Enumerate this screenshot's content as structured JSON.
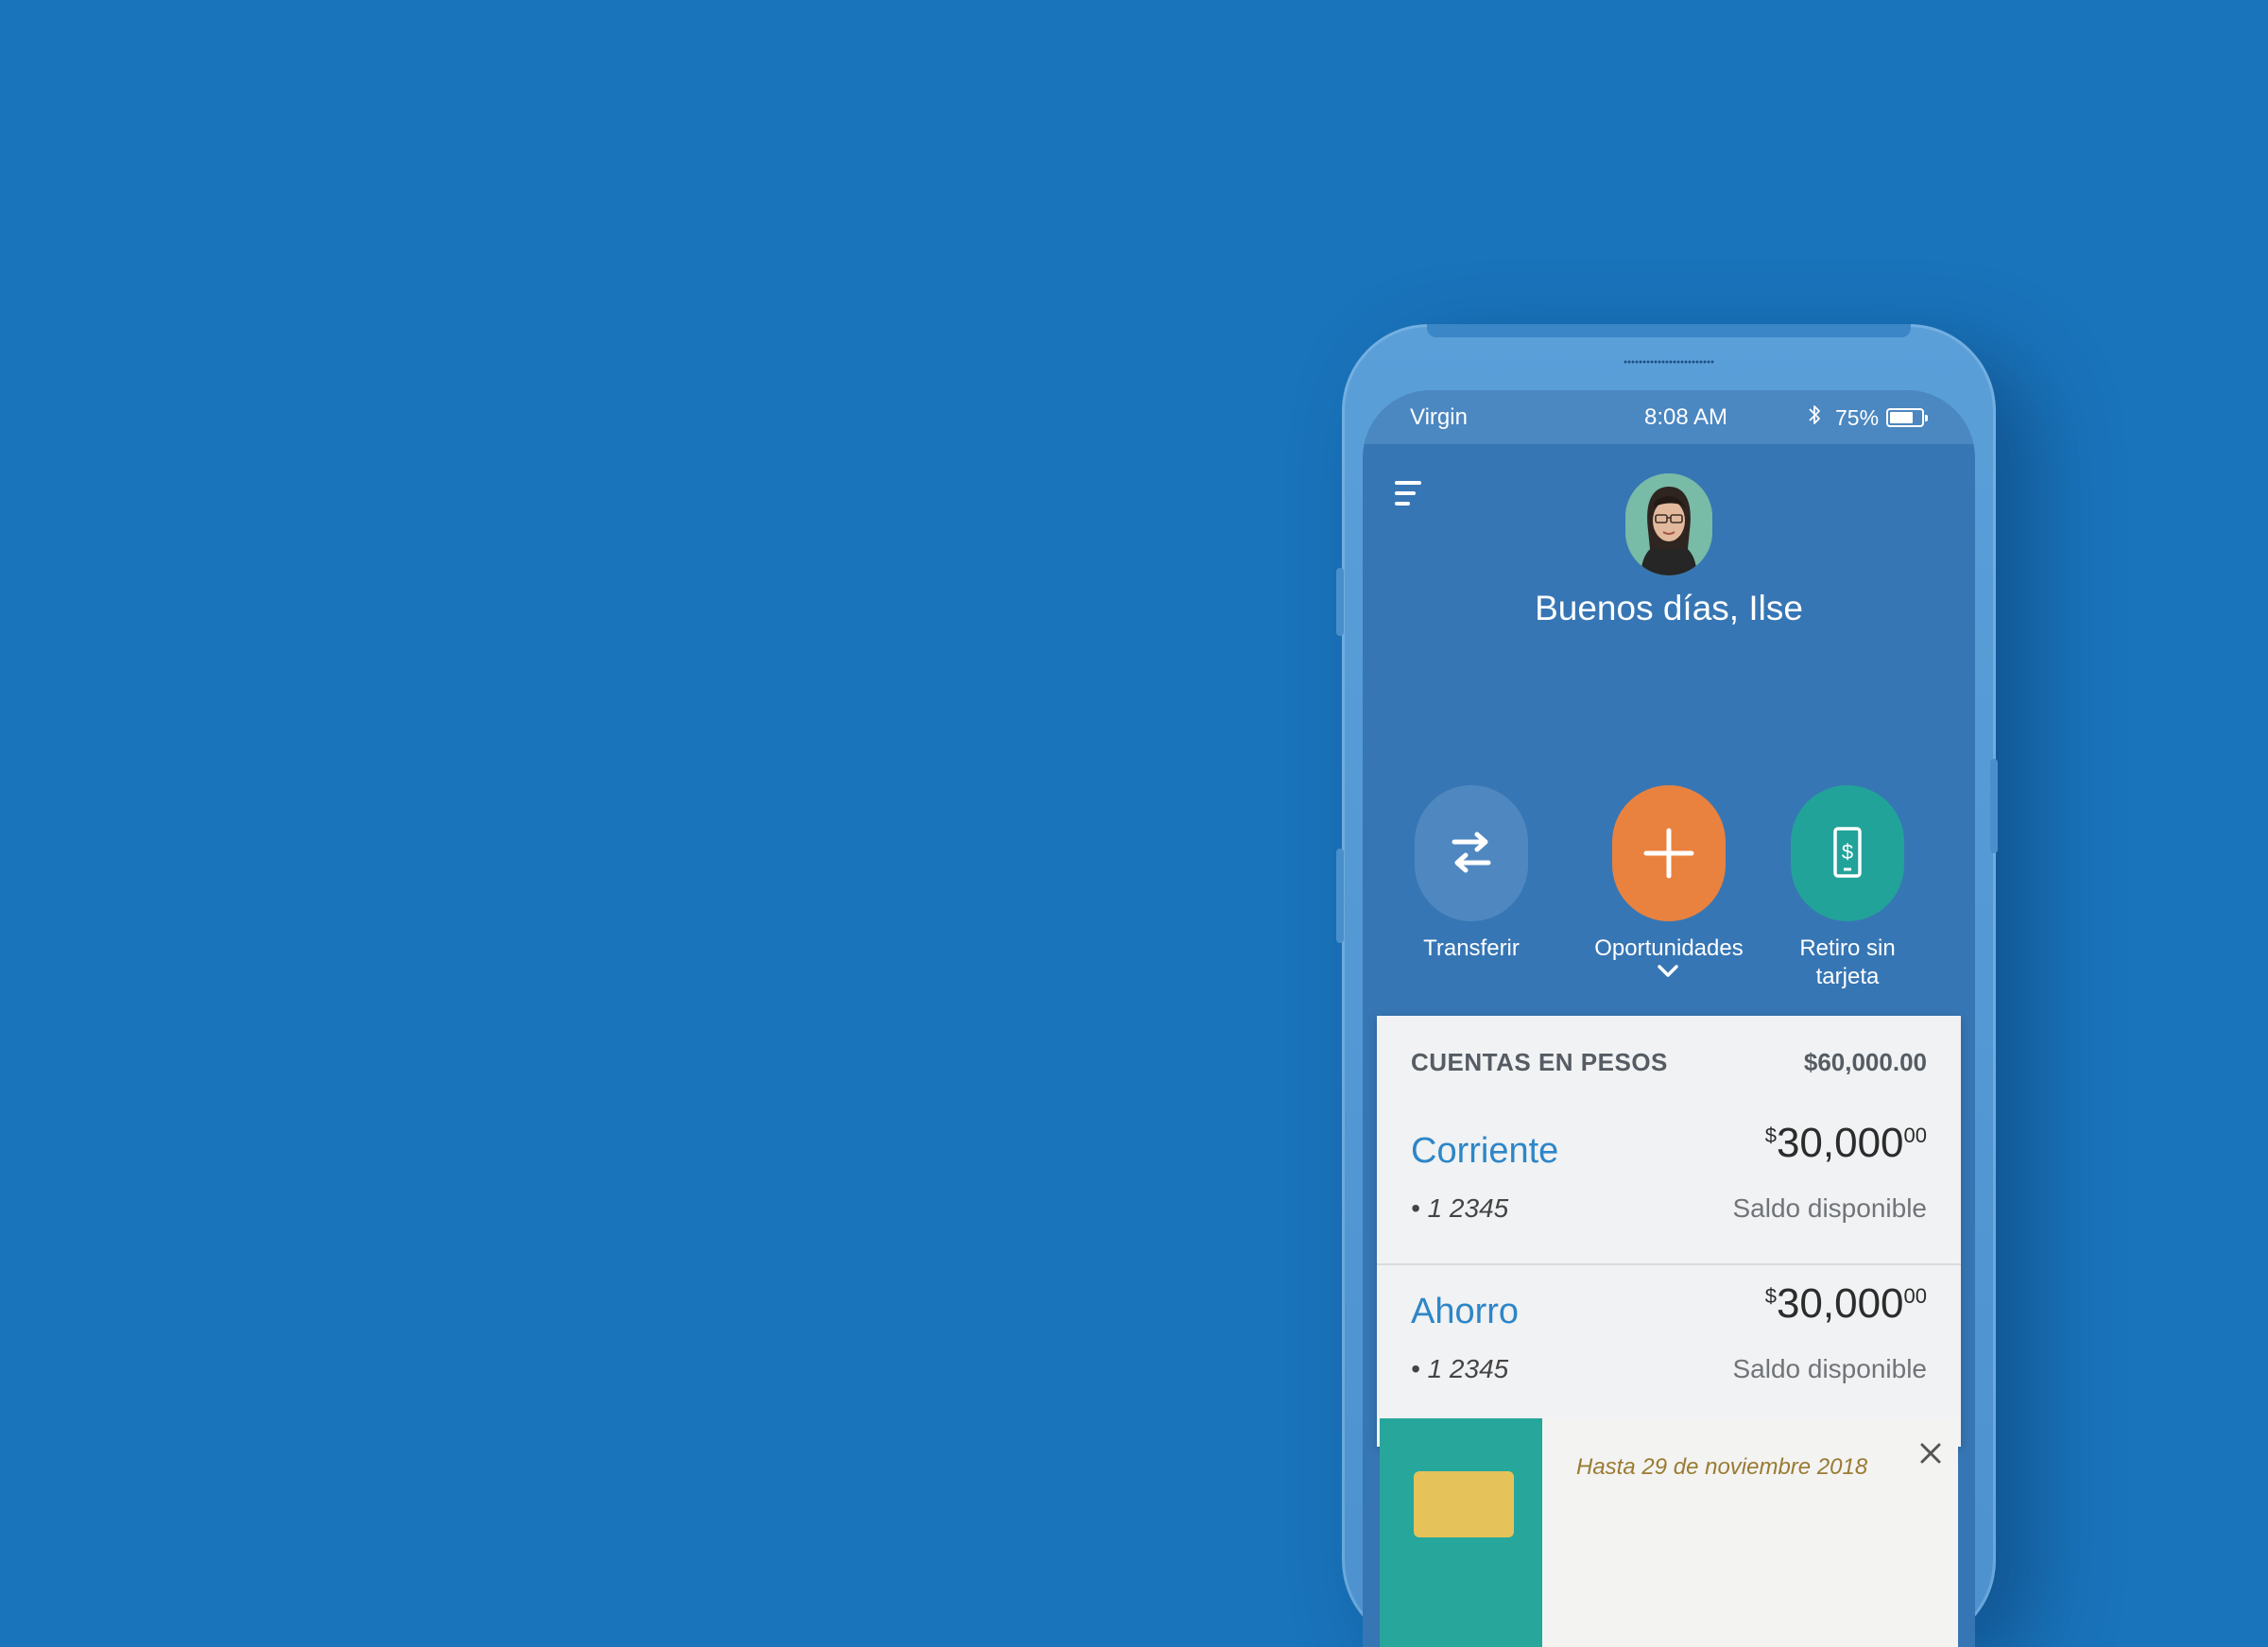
{
  "colors": {
    "background": "#1a74bb",
    "screen": "#3776b4",
    "transfer_button": "#4f88c0",
    "opportunities_button": "#e9823f",
    "cardless_button": "#21a39a",
    "account_name": "#2d86c8"
  },
  "status_bar": {
    "carrier": "Virgin",
    "time": "8:08 AM",
    "battery_percent": "75%",
    "battery_level": 0.75,
    "bluetooth_icon": "bluetooth-icon"
  },
  "header": {
    "menu_icon": "hamburger-menu-icon",
    "greeting": "Buenos días, Ilse"
  },
  "actions": [
    {
      "label": "Transferir",
      "icon": "transfer-arrows-icon"
    },
    {
      "label": "Oportunidades",
      "icon": "plus-icon"
    },
    {
      "label_line1": "Retiro sin",
      "label_line2": "tarjeta",
      "icon": "phone-dollar-icon"
    }
  ],
  "accounts_card": {
    "title": "CUENTAS EN PESOS",
    "total": "$60,000.00",
    "items": [
      {
        "name": "Corriente",
        "number": "• 1 2345",
        "currency": "$",
        "amount_whole": "30,000",
        "amount_cents": "00",
        "subtitle": "Saldo disponible"
      },
      {
        "name": "Ahorro",
        "number": "• 1 2345",
        "currency": "$",
        "amount_whole": "30,000",
        "amount_cents": "00",
        "subtitle": "Saldo disponible"
      }
    ]
  },
  "promo": {
    "date_text": "Hasta 29 de noviembre 2018",
    "close_icon": "close-icon"
  }
}
